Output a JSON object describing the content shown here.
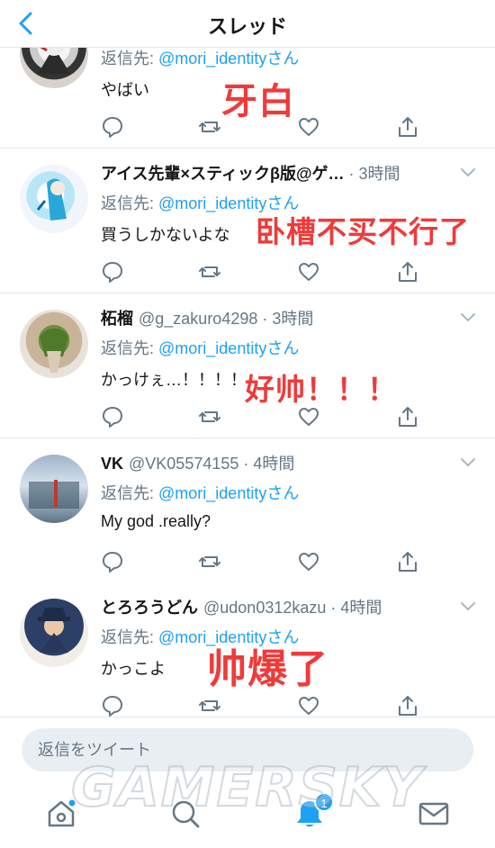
{
  "header": {
    "title": "スレッド"
  },
  "tweets": [
    {
      "name": "",
      "handle": "",
      "time": "",
      "reply_label": "返信先: ",
      "reply_mention": "@mori_identityさん",
      "text": "やばい",
      "overlay": "牙白"
    },
    {
      "name": "アイス先輩×スティックβ版@ゲ…",
      "handle": "",
      "time": " · 3時間",
      "reply_label": "返信先: ",
      "reply_mention": "@mori_identityさん",
      "text": "買うしかないよな",
      "overlay": "卧槽不买不行了"
    },
    {
      "name": "柘榴",
      "handle": "@g_zakuro4298",
      "time": " · 3時間",
      "reply_label": "返信先: ",
      "reply_mention": "@mori_identityさん",
      "text": "かっけぇ…！！！！",
      "overlay": "好帅！！！"
    },
    {
      "name": "VK",
      "handle": "@VK05574155",
      "time": " · 4時間",
      "reply_label": "返信先: ",
      "reply_mention": "@mori_identityさん",
      "text": "My god .really?",
      "overlay": ""
    },
    {
      "name": "とろろうどん",
      "handle": "@udon0312kazu",
      "time": " · 4時間",
      "reply_label": "返信先: ",
      "reply_mention": "@mori_identityさん",
      "text": "かっこよ",
      "overlay": "帅爆了"
    }
  ],
  "composer": {
    "placeholder": "返信をツイート"
  },
  "watermark": "GAMERSKY",
  "tabbar": {
    "notifications_badge": "1"
  },
  "colors": {
    "accent": "#1da1f2",
    "text": "#14171a",
    "secondary": "#657786",
    "divider": "#e1e8ed",
    "overlay_red": "#f03a3a"
  }
}
